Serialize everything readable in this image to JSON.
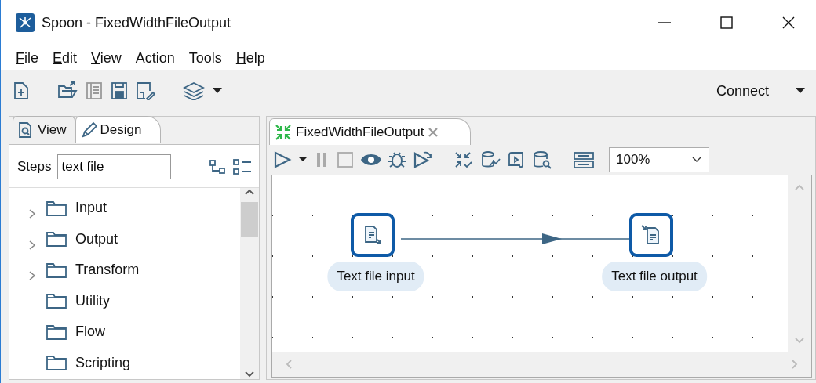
{
  "window": {
    "title": "Spoon - FixedWidthFileOutput"
  },
  "menu": [
    {
      "label": "File",
      "underlined_first": true
    },
    {
      "label": "Edit",
      "underlined_first": true
    },
    {
      "label": "View",
      "underlined_first": true
    },
    {
      "label": "Action",
      "underlined_first": false
    },
    {
      "label": "Tools",
      "underlined_first": false
    },
    {
      "label": "Help",
      "underlined_first": true
    }
  ],
  "toolbar": {
    "connect": "Connect"
  },
  "left_tabs": [
    {
      "label": "View",
      "selected": false
    },
    {
      "label": "Design",
      "selected": true
    }
  ],
  "steps": {
    "label": "Steps",
    "value": "text file"
  },
  "tree": [
    {
      "label": "Input",
      "expandable": true
    },
    {
      "label": "Output",
      "expandable": true
    },
    {
      "label": "Transform",
      "expandable": true
    },
    {
      "label": "Utility",
      "expandable": false
    },
    {
      "label": "Flow",
      "expandable": false
    },
    {
      "label": "Scripting",
      "expandable": false
    }
  ],
  "editor_tab": {
    "title": "FixedWidthFileOutput"
  },
  "zoom": {
    "value": "100%"
  },
  "canvas": {
    "steps": [
      {
        "name": "Text file input",
        "kind": "input"
      },
      {
        "name": "Text file output",
        "kind": "output"
      }
    ]
  }
}
